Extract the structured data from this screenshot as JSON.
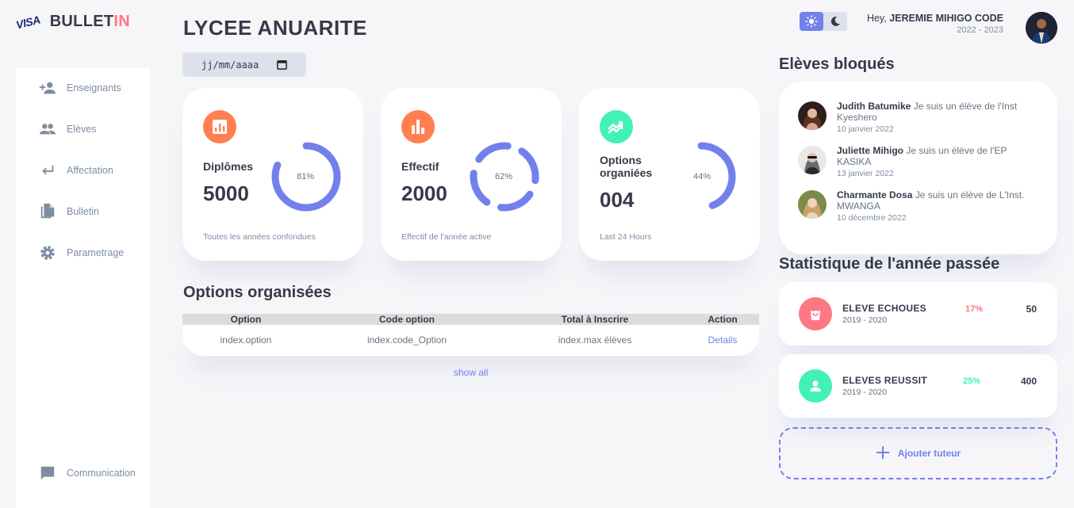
{
  "logo": {
    "badge": "VISA",
    "text_main": "BULLET",
    "text_accent": "IN"
  },
  "sidebar": {
    "items": [
      {
        "label": "Enseignants",
        "icon": "person-add-icon"
      },
      {
        "label": "Elèves",
        "icon": "group-icon"
      },
      {
        "label": "Affectation",
        "icon": "return-arrow-icon"
      },
      {
        "label": "Bulletin",
        "icon": "file-copy-icon"
      },
      {
        "label": "Parametrage",
        "icon": "gear-icon"
      },
      {
        "label": "Communication",
        "icon": "chat-icon"
      }
    ]
  },
  "header": {
    "title": "LYCEE ANUARITE",
    "date_placeholder": "jj/mm/aaaa",
    "greeting": "Hey,",
    "user_name": "JEREMIE MIHIGO CODE",
    "school_year": "2022 - 2023"
  },
  "cards": [
    {
      "title": "Diplômes",
      "value": "5000",
      "percent_label": "81%",
      "percent": 0.81,
      "footer": "Toutes les années confondues",
      "icon_color": "#ff7f50",
      "icon": "bar-chart-square-icon"
    },
    {
      "title": "Effectif",
      "value": "2000",
      "percent_label": "62%",
      "percent": 0.62,
      "footer": "Effectif de l'année active",
      "icon_color": "#ff7f50",
      "icon": "bar-chart-icon"
    },
    {
      "title": "Options organiées",
      "value": "004",
      "percent_label": "44%",
      "percent": 0.44,
      "footer": "Last 24 Hours",
      "icon_color": "#41f1b6",
      "icon": "trending-icon"
    }
  ],
  "options": {
    "title": "Options organisées",
    "headers": [
      "Option",
      "Code option",
      "Total à Inscrire",
      "Action"
    ],
    "row": [
      "index.option",
      "index.code_Option",
      "index.max élèves",
      "Details"
    ],
    "show_all": "show all"
  },
  "blocked": {
    "title": "Elèves bloqués",
    "students": [
      {
        "name": "Judith Batumike",
        "msg": "Je suis un élève de l'Inst Kyeshero",
        "date": "10 janvier 2022"
      },
      {
        "name": "Juliette Mihigo",
        "msg": "Je suis un élève de l'EP KASIKA",
        "date": "13 janvier 2022"
      },
      {
        "name": "Charmante Dosa",
        "msg": "Je suis un élève de L'Inst. MWANGA",
        "date": "10 décembre 2022"
      }
    ]
  },
  "stats": {
    "title": "Statistique de l'année passée",
    "items": [
      {
        "name": "ELEVE ECHOUES",
        "year": "2019 - 2020",
        "percent": "17%",
        "value": "50",
        "color": "#ff7782",
        "icon": "shopping-bag-icon"
      },
      {
        "name": "ELEVES REUSSIT",
        "year": "2019 - 2020",
        "percent": "25%",
        "value": "400",
        "color": "#41f1b6",
        "icon": "person-icon"
      }
    ],
    "add_label": "Ajouter tuteur"
  },
  "colors": {
    "primary": "#7380ec",
    "danger": "#ff7782",
    "success": "#41f1b6",
    "warning": "#ff7f50"
  }
}
